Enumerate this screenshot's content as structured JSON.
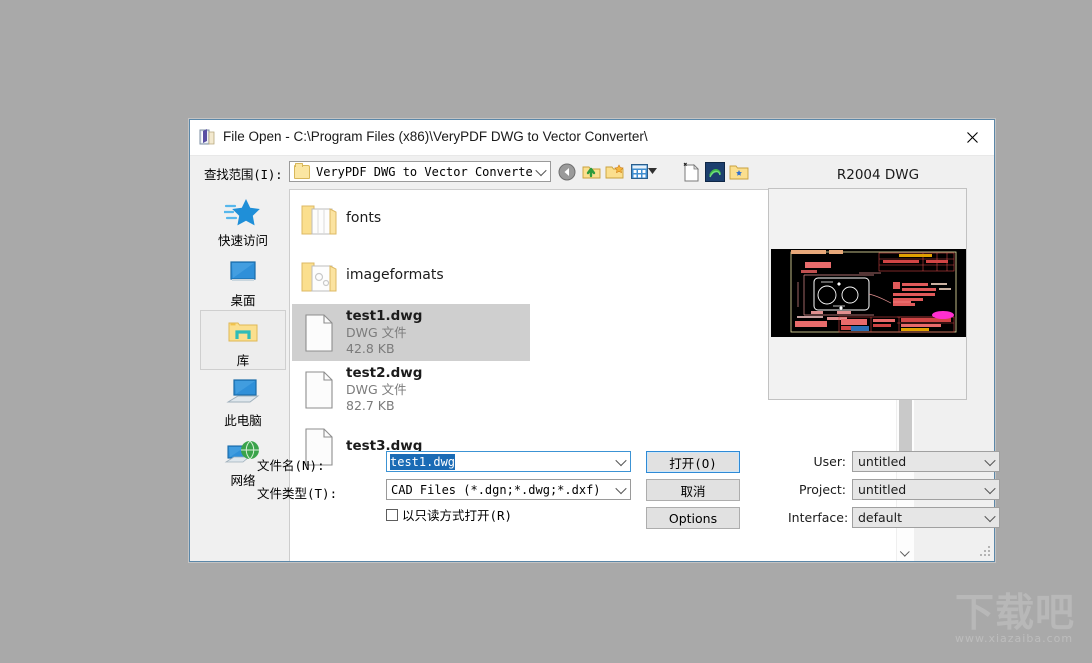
{
  "window": {
    "title": "File Open - C:\\Program Files (x86)\\VeryPDF DWG to Vector Converter\\",
    "icon": "app-icon",
    "close_label": "✕"
  },
  "lookin": {
    "label": "查找范围(I):",
    "value": "VeryPDF DWG to Vector Converter"
  },
  "toolbar": {
    "items": [
      {
        "name": "back-icon",
        "tooltip": "Back"
      },
      {
        "name": "up-folder-icon",
        "tooltip": "Up one level"
      },
      {
        "name": "new-folder-icon",
        "tooltip": "Create New Folder"
      },
      {
        "name": "view-mode-icon",
        "tooltip": "Views"
      },
      {
        "name": "new-file-icon",
        "tooltip": "New"
      },
      {
        "name": "converter-logo-icon",
        "tooltip": "VeryPDF"
      },
      {
        "name": "favorite-folder-icon",
        "tooltip": "Favorites"
      }
    ]
  },
  "sidebar": {
    "items": [
      {
        "label": "快速访问",
        "icon": "quick-access-star-icon",
        "selected": false
      },
      {
        "label": "桌面",
        "icon": "desktop-monitor-icon",
        "selected": false
      },
      {
        "label": "库",
        "icon": "library-folder-icon",
        "selected": true
      },
      {
        "label": "此电脑",
        "icon": "this-pc-icon",
        "selected": false
      },
      {
        "label": "网络",
        "icon": "network-globe-icon",
        "selected": false
      }
    ]
  },
  "filelist": {
    "rows": [
      {
        "name": "fonts",
        "type": "",
        "size": "",
        "kind": "folder",
        "selected": false
      },
      {
        "name": "imageformats",
        "type": "",
        "size": "",
        "kind": "folder",
        "selected": false
      },
      {
        "name": "test1.dwg",
        "type": "DWG 文件",
        "size": "42.8 KB",
        "kind": "file",
        "selected": true
      },
      {
        "name": "test2.dwg",
        "type": "DWG 文件",
        "size": "82.7 KB",
        "kind": "file",
        "selected": false
      },
      {
        "name": "test3.dwg",
        "type": "",
        "size": "",
        "kind": "file",
        "selected": false
      }
    ]
  },
  "form": {
    "filename_label": "文件名(N):",
    "filename_value": "test1.dwg",
    "filetype_label": "文件类型(T):",
    "filetype_value": "CAD Files (*.dgn;*.dwg;*.dxf)",
    "readonly_label": "以只读方式打开(R)",
    "readonly_checked": false
  },
  "buttons": {
    "open": "打开(O)",
    "cancel": "取消",
    "options": "Options"
  },
  "preview": {
    "title": "R2004 DWG"
  },
  "right_panel": {
    "fields": [
      {
        "label": "User:",
        "value": "untitled"
      },
      {
        "label": "Project:",
        "value": "untitled"
      },
      {
        "label": "Interface:",
        "value": "default"
      }
    ]
  },
  "watermark": {
    "text": "下载吧",
    "url": "www.xiazaiba.com"
  },
  "colors": {
    "background": "#a9a9a9",
    "dialog": "#f0f0f0",
    "titlebar": "#ffffff",
    "accent": "#2e8ad6",
    "selection": "#cfcfcf",
    "text_selection": "#1a6bb5",
    "preview_bg": "#000000"
  }
}
